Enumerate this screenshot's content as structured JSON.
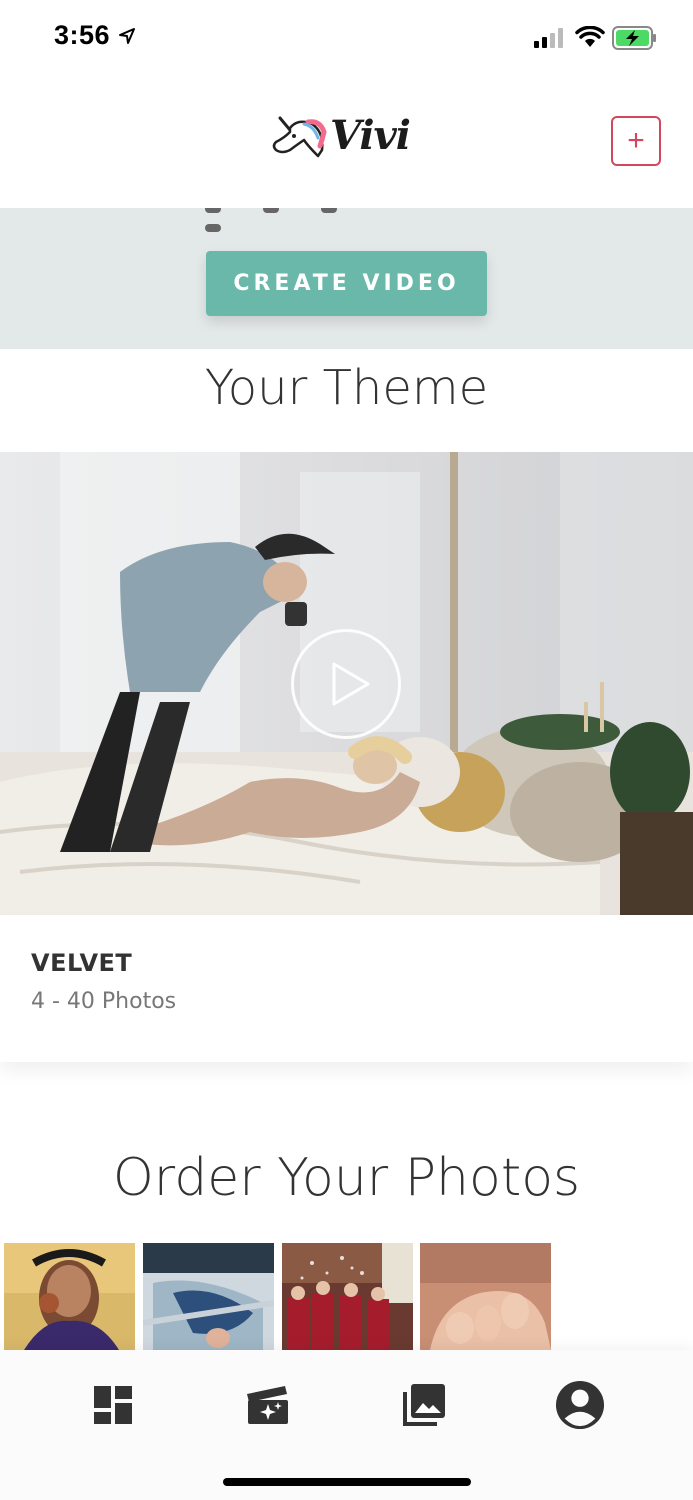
{
  "status_bar": {
    "time": "3:56"
  },
  "header": {
    "logo_text": "Vivi",
    "add_button_label": "+",
    "brand_color": "#d2475e"
  },
  "create_section": {
    "button_label": "CREATE VIDEO",
    "button_color": "#69b8aa"
  },
  "theme_section": {
    "title": "Your Theme",
    "theme_name": "VELVET",
    "photo_range": "4 - 40 Photos"
  },
  "order_section": {
    "title": "Order Your Photos"
  },
  "tab_bar": {
    "tabs": [
      {
        "icon": "dashboard-icon"
      },
      {
        "icon": "video-create-icon"
      },
      {
        "icon": "photo-library-icon"
      },
      {
        "icon": "account-icon"
      }
    ]
  }
}
